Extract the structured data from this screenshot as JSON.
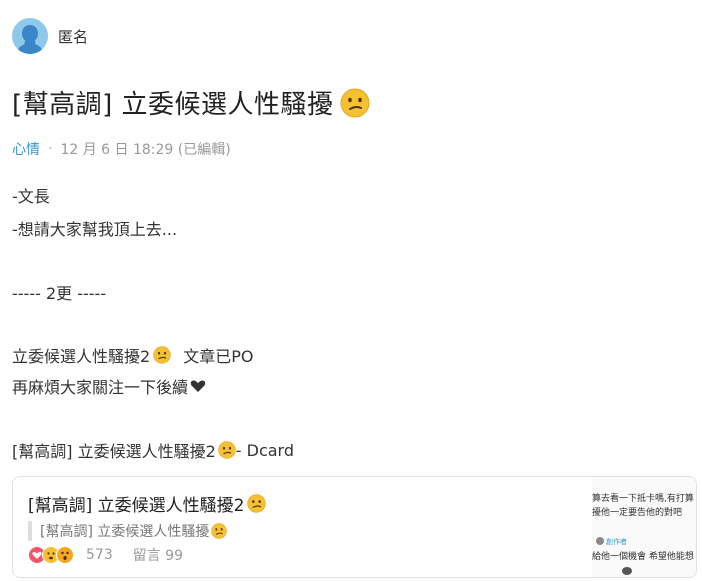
{
  "author": {
    "name": "匿名",
    "avatar_icon": "anonymous-avatar-icon",
    "avatar_color": "#8ec9ea"
  },
  "post": {
    "title": "[幫高調] 立委候選人性騷擾",
    "title_emoji": "confused-face-emoji",
    "forum": "心情",
    "separator": "·",
    "date": "12 月 6 日 18:29 (已編輯)",
    "body": {
      "line1": "-文長",
      "line2": "-想請大家幫我頂上去...",
      "line3": "----- 2更 -----",
      "line4a": "立委候選人性騷擾2",
      "line4b": "文章已PO",
      "line5": "再麻煩大家關注一下後續",
      "line5_icon": "black-heart-icon",
      "line6a": "[幫高調] 立委候選人性騷擾2",
      "line6b": " - Dcard"
    }
  },
  "link_card": {
    "title": "[幫高調] 立委候選人性騷擾2",
    "excerpt": "[幫高調] 立委候選人性騷擾",
    "reaction_count": "573",
    "comment_label": "留言 99",
    "reaction_icons": [
      "heart-reaction-icon",
      "shocked-reaction-icon",
      "wow-reaction-icon"
    ],
    "thumbnail": {
      "line1": "算去看一下抵卡嗎,有打算",
      "line2": "擾他一定要告他的對吧",
      "line3": "給他一個機會 希望他能想",
      "tag": "創作者"
    }
  },
  "colors": {
    "accent": "#3397cf",
    "emoji_face": "#f6c033"
  }
}
